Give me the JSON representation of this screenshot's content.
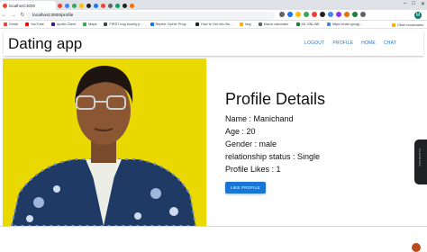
{
  "browser": {
    "active_tab_title": "localhost:3000",
    "url": "localhost:3000/profile",
    "profile_initial": "M",
    "bookmarks": [
      {
        "label": "Gmail",
        "color": "#ea4335"
      },
      {
        "label": "YouTube",
        "color": "#ff0000"
      },
      {
        "label": "Apollo Client",
        "color": "#311c87"
      },
      {
        "label": "Maps",
        "color": "#34a853"
      },
      {
        "label": "FIRST bug bounty p...",
        "color": "#444444"
      },
      {
        "label": "Replier Cipher Prog...",
        "color": "#1a73e8"
      },
      {
        "label": "How to Get Into Bu...",
        "color": "#222222"
      },
      {
        "label": "bug",
        "color": "#f9ab00"
      },
      {
        "label": "Macro calculator",
        "color": "#5f6368"
      },
      {
        "label": "ML ONLINE",
        "color": "#188038"
      },
      {
        "label": "https://main.googl...",
        "color": "#4285f4"
      }
    ],
    "other_bookmarks": "Other bookmarks"
  },
  "app": {
    "brand": "Dating app",
    "nav": [
      "LOGOUT",
      "PROFILE",
      "HOME",
      "CHAT"
    ]
  },
  "profile": {
    "heading": "Profile Details",
    "name": "Name : Manichand",
    "age": "Age : 20",
    "gender": "Gender : male",
    "relationship": "relationship status : Single",
    "likes": "Profile Likes : 1",
    "like_button": "LIKE PROFILE"
  },
  "side_widget_label": "FEEDBACK"
}
